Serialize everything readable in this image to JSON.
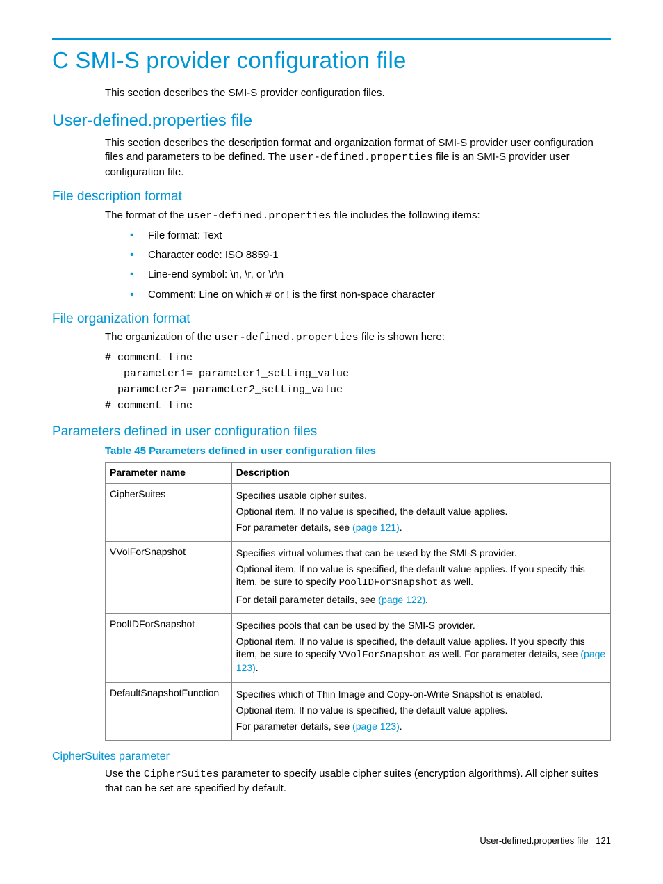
{
  "title": "C SMI-S provider configuration file",
  "intro": "This section describes the SMI-S provider configuration files.",
  "sec1": {
    "heading": "User-defined.properties file",
    "para_a": "This section describes the description format and organization format of SMI-S provider user configuration files and parameters to be defined. The ",
    "code": "user-defined.properties",
    "para_b": " file is an SMI-S provider user configuration file."
  },
  "sec2": {
    "heading": "File description format",
    "lead_a": "The format of the ",
    "code": "user-defined.properties",
    "lead_b": " file includes the following items:",
    "items": [
      "File format: Text",
      "Character code: ISO 8859-1",
      "Line-end symbol: \\n, \\r, or \\r\\n",
      "Comment: Line on which # or ! is the first non-space character"
    ]
  },
  "sec3": {
    "heading": "File organization format",
    "lead_a": "The organization of the ",
    "code": "user-defined.properties",
    "lead_b": " file is shown here:",
    "pre": "# comment line\n   parameter1= parameter1_setting_value\n  parameter2= parameter2_setting_value\n# comment line"
  },
  "sec4": {
    "heading": "Parameters defined in user configuration files",
    "table_caption": "Table 45 Parameters defined in user configuration files",
    "th1": "Parameter name",
    "th2": "Description",
    "rows": [
      {
        "name": "CipherSuites",
        "p1": "Specifies usable cipher suites.",
        "p2": "Optional item. If no value is specified, the default value applies.",
        "p3a": "For parameter details, see ",
        "p3link": "(page 121)",
        "p3b": "."
      },
      {
        "name": "VVolForSnapshot",
        "p1": "Specifies virtual volumes that can be used by the SMI-S provider.",
        "p2a": "Optional item. If no value is specified, the default value applies. If you specify this item, be sure to specify ",
        "p2code": "PoolIDForSnapshot",
        "p2b": " as well.",
        "p3a": "For detail parameter details, see ",
        "p3link": "(page 122)",
        "p3b": "."
      },
      {
        "name": "PoolIDForSnapshot",
        "p1": "Specifies pools that can be used by the SMI-S provider.",
        "p2a": "Optional item. If no value is specified, the default value applies. If you specify this item, be sure to specify ",
        "p2code": "VVolForSnapshot",
        "p2b": " as well. For parameter details, see ",
        "p2link": "(page 123)",
        "p2c": "."
      },
      {
        "name": "DefaultSnapshotFunction",
        "p1": "Specifies which of Thin Image and Copy-on-Write Snapshot is enabled.",
        "p2": "Optional item. If no value is specified, the default value applies.",
        "p3a": "For parameter details, see ",
        "p3link": "(page 123)",
        "p3b": "."
      }
    ]
  },
  "sec5": {
    "heading": "CipherSuites parameter",
    "para_a": "Use the ",
    "code": "CipherSuites",
    "para_b": " parameter to specify usable cipher suites (encryption algorithms). All cipher suites that can be set are specified by default."
  },
  "footer": {
    "text": "User-defined.properties file",
    "page": "121"
  }
}
